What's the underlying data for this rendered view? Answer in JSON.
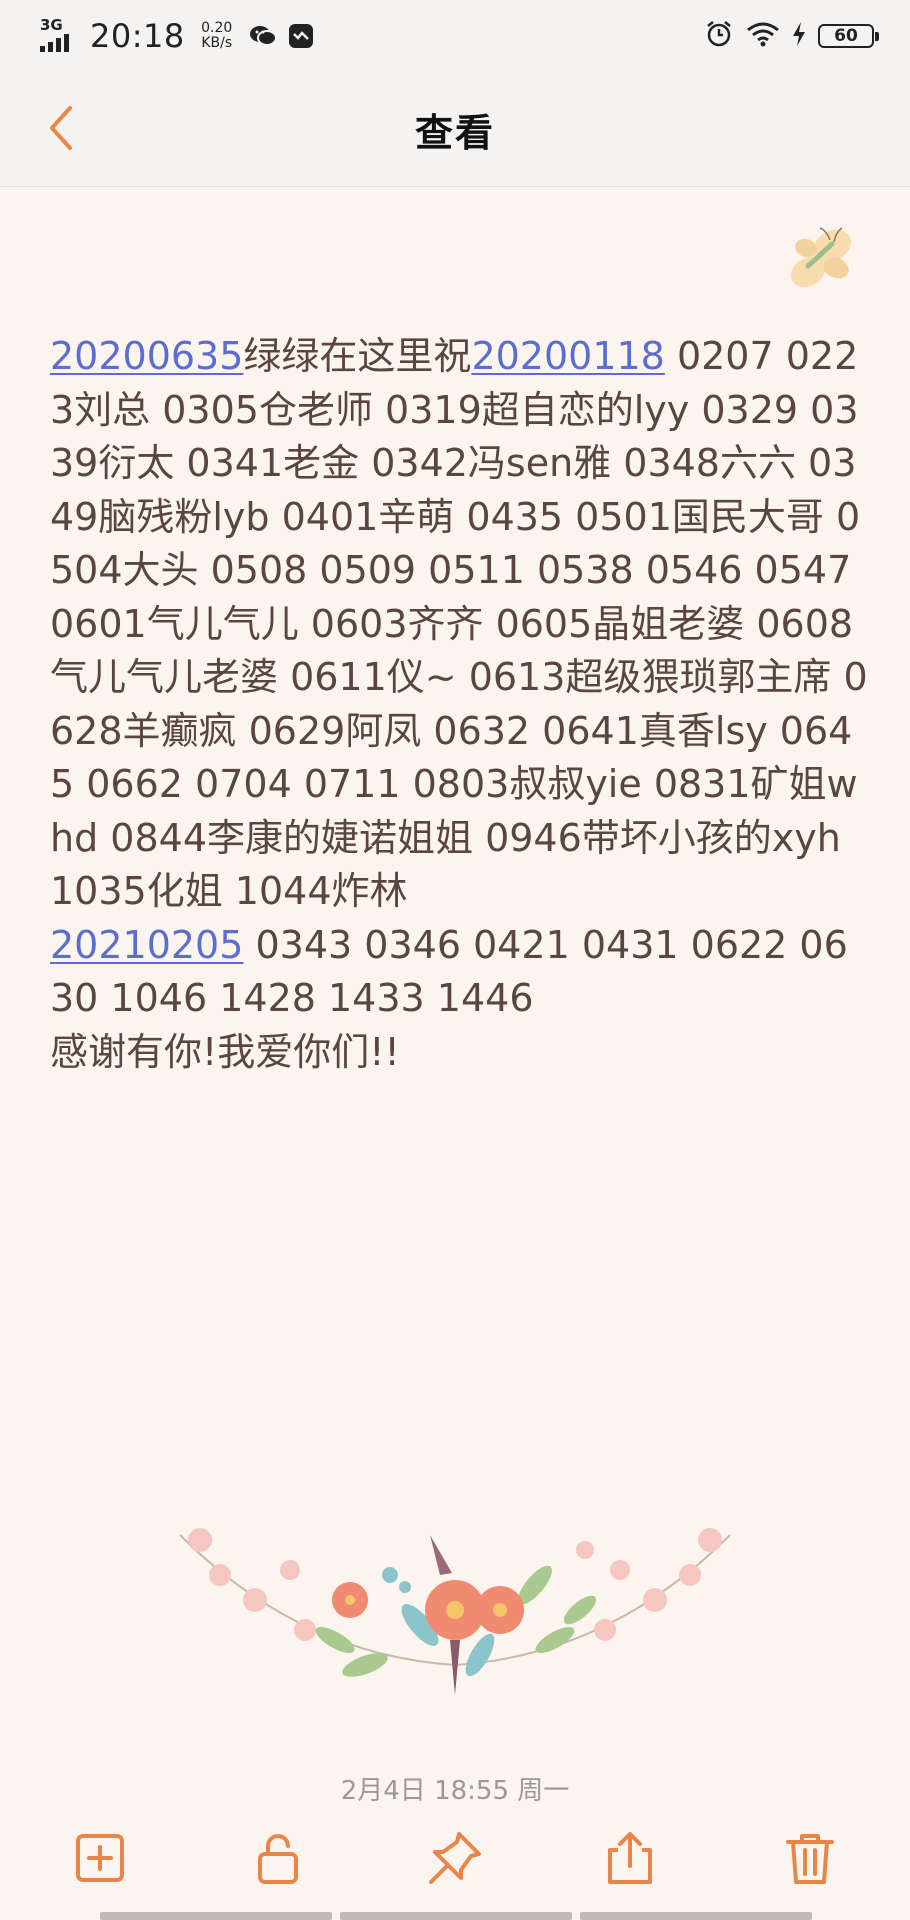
{
  "status_bar": {
    "network": "3G",
    "time": "20:18",
    "speed_value": "0.20",
    "speed_unit": "KB/s",
    "battery": "60"
  },
  "header": {
    "title": "查看"
  },
  "note": {
    "segments": [
      {
        "text": "20200635",
        "link": true
      },
      {
        "text": "绿绿在这里祝",
        "link": false
      },
      {
        "text": "20200118",
        "link": true
      },
      {
        "text": " 0207 0223刘总 0305仓老师 0319超自恋的lyy 0329 0339衍太 0341老金 0342冯sen雅 0348六六 0349脑残粉lyb 0401辛萌 0435 0501国民大哥 0504大头 0508 0509 0511 0538 0546 0547 0601气儿气儿 0603齐齐 0605晶姐老婆 0608气儿气儿老婆 0611仪~ 0613超级猥琐郭主席 0628羊癫疯 0629阿凤 0632 0641真香lsy 0645 0662 0704 0711 0803叔叔yie 0831矿姐whd 0844李康的婕诺姐姐 0946带坏小孩的xyh 1035化姐 1044炸林",
        "link": false
      },
      {
        "text": "\n",
        "link": false
      },
      {
        "text": "20210205",
        "link": true
      },
      {
        "text": " 0343 0346 0421 0431 0622 0630 1046 1428 1433 1446",
        "link": false
      },
      {
        "text": "\n",
        "link": false
      },
      {
        "text": "感谢有你!我爱你们!!",
        "link": false
      }
    ]
  },
  "timestamp": "2月4日 18:55 周一",
  "toolbar": {
    "items": [
      "add-note",
      "unlock",
      "pin",
      "share",
      "delete"
    ]
  },
  "colors": {
    "accent": "#e8864a",
    "link": "#5b6ed0",
    "background": "#fcf4ef",
    "text": "#5a4640"
  }
}
